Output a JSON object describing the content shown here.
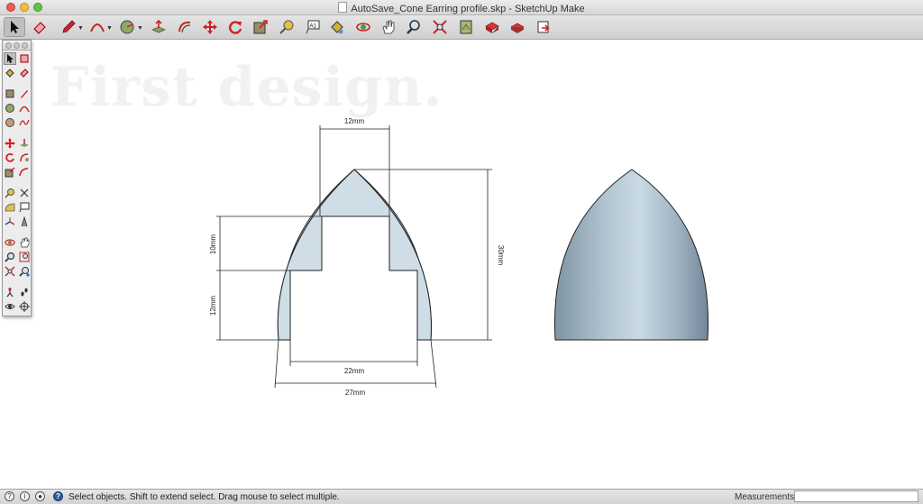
{
  "window": {
    "title": "AutoSave_Cone Earring profile.skp - SketchUp Make"
  },
  "toolbar": {
    "tools": [
      {
        "name": "select",
        "selected": true
      },
      {
        "name": "eraser"
      },
      {
        "name": "line"
      },
      {
        "name": "arc"
      },
      {
        "name": "shapes"
      },
      {
        "name": "push-pull"
      },
      {
        "name": "offset"
      },
      {
        "name": "move"
      },
      {
        "name": "rotate"
      },
      {
        "name": "scale"
      },
      {
        "name": "tape-measure"
      },
      {
        "name": "text"
      },
      {
        "name": "paint-bucket"
      },
      {
        "name": "orbit"
      },
      {
        "name": "pan"
      },
      {
        "name": "zoom"
      },
      {
        "name": "zoom-extents"
      },
      {
        "name": "3d-warehouse"
      },
      {
        "name": "extension-warehouse"
      },
      {
        "name": "share-model"
      },
      {
        "name": "layout"
      }
    ]
  },
  "watermark": "First design.",
  "dimensions": {
    "top_width": "12mm",
    "upper_height": "10mm",
    "lower_height": "12mm",
    "total_height": "30mm",
    "inner_width": "22mm",
    "outer_width": "27mm"
  },
  "colors": {
    "profile_fill": "#cfdde6",
    "solid_fill": "#b6c9d5"
  },
  "status": {
    "message": "Select objects. Shift to extend select. Drag mouse to select multiple.",
    "measurements_label": "Measurements",
    "measurements_value": ""
  }
}
